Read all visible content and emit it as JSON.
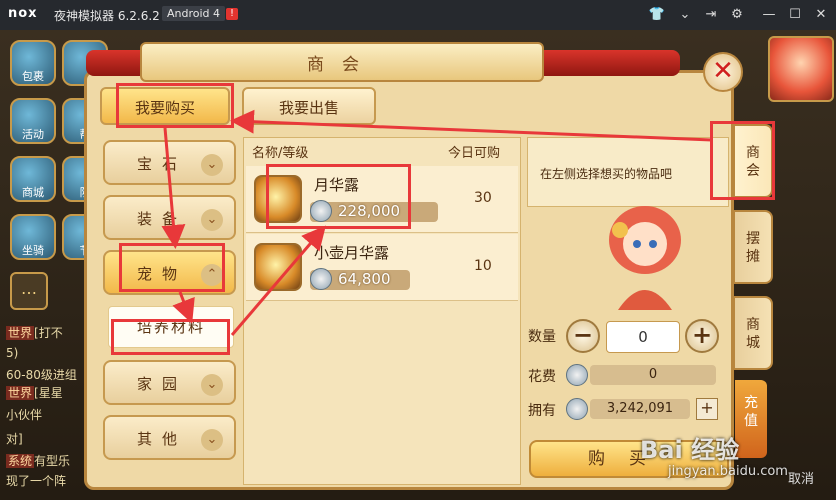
{
  "titlebar": {
    "logo": "nox",
    "title": "夜神模拟器 6.2.6.2",
    "android": "Android 4",
    "alert": "!"
  },
  "hud": {
    "icons": [
      "包裹",
      "活动",
      "帮",
      "商城",
      "队",
      "坐骑",
      "节"
    ],
    "chat": [
      {
        "channel": "世界",
        "text": "[打不"
      },
      {
        "channel": "",
        "text": "5)"
      },
      {
        "channel": "",
        "text": "60-80级进组"
      },
      {
        "channel": "世界",
        "text": "[星星"
      },
      {
        "channel": "",
        "text": "小伙伴"
      },
      {
        "channel": "",
        "text": "对]"
      },
      {
        "channel": "系统",
        "text": "有型乐"
      },
      {
        "channel": "",
        "text": "现了一个阵"
      }
    ],
    "cancel": "取消"
  },
  "window": {
    "title": "商会",
    "tabs": {
      "buy": "我要购买",
      "sell": "我要出售"
    },
    "categories": [
      {
        "label": "宝石",
        "chev": "⌄"
      },
      {
        "label": "装备",
        "chev": "⌄"
      },
      {
        "label": "宠物",
        "chev": "⌃"
      },
      {
        "label": "家园",
        "chev": "⌄"
      },
      {
        "label": "其他",
        "chev": "⌄"
      }
    ],
    "subcategory": "培养材料",
    "list": {
      "col_name": "名称/等级",
      "col_qty": "今日可购",
      "items": [
        {
          "name": "月华露",
          "price": "228,000",
          "qty": "30"
        },
        {
          "name": "小壶月华露",
          "price": "64,800",
          "qty": "10"
        }
      ]
    },
    "hint": "在左侧选择想买的物品吧",
    "qty_label": "数量",
    "qty_value": "0",
    "cost_label": "花费",
    "cost_value": "0",
    "own_label": "拥有",
    "own_value": "3,242,091",
    "buy_button": "购买",
    "side_tabs": [
      "商会",
      "摆摊",
      "商城"
    ],
    "topup": "充值"
  },
  "watermark": {
    "logo": "Bai 经验",
    "sub": "jingyan.baidu.com"
  },
  "colors": {
    "annotation": "#e8383a",
    "tab_active": "#f2b84a",
    "panel": "#efd9a6"
  }
}
